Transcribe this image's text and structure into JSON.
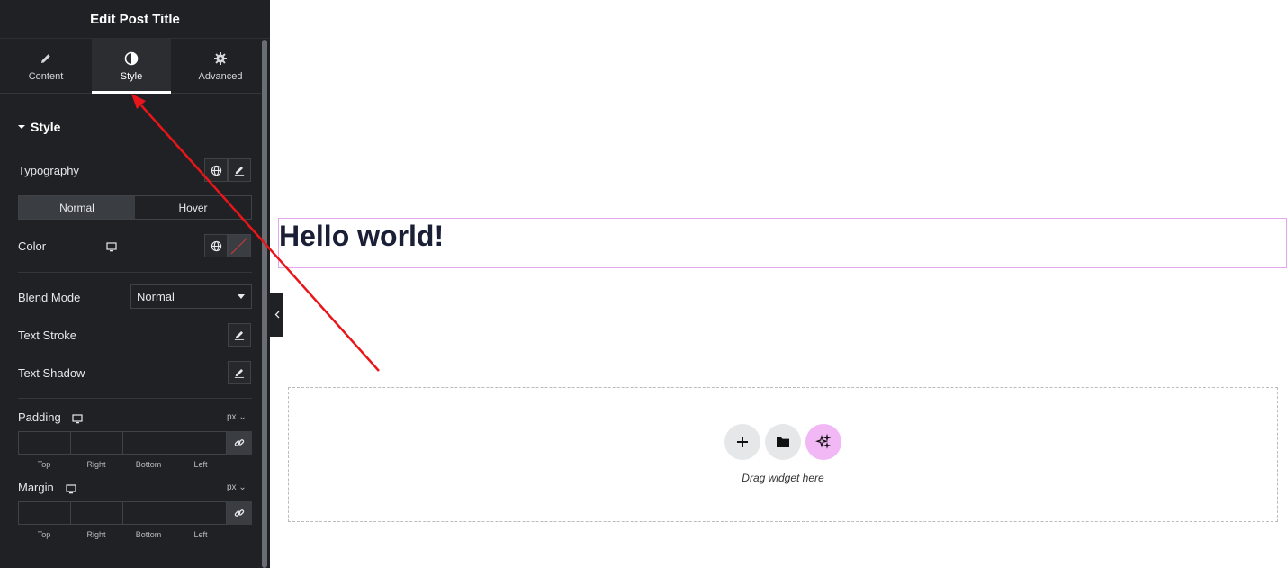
{
  "panel": {
    "title": "Edit Post Title",
    "tabs": [
      {
        "label": "Content",
        "icon": "pencil-icon"
      },
      {
        "label": "Style",
        "icon": "half-circle-icon",
        "active": true
      },
      {
        "label": "Advanced",
        "icon": "gear-icon"
      }
    ],
    "section_title": "Style",
    "typography_label": "Typography",
    "state_tabs": {
      "normal": "Normal",
      "hover": "Hover"
    },
    "color_label": "Color",
    "blend_mode_label": "Blend Mode",
    "blend_mode_value": "Normal",
    "text_stroke_label": "Text Stroke",
    "text_shadow_label": "Text Shadow",
    "padding_label": "Padding",
    "padding_unit": "px",
    "margin_label": "Margin",
    "margin_unit": "px",
    "dim_labels": {
      "top": "Top",
      "right": "Right",
      "bottom": "Bottom",
      "left": "Left"
    }
  },
  "canvas": {
    "heading_text": "Hello world!",
    "drop_text": "Drag widget here"
  },
  "colors": {
    "panel_bg": "#202124",
    "selection_border": "#e5a6f0",
    "ai_button": "#f1b8f5",
    "arrow": "#e8161a"
  }
}
